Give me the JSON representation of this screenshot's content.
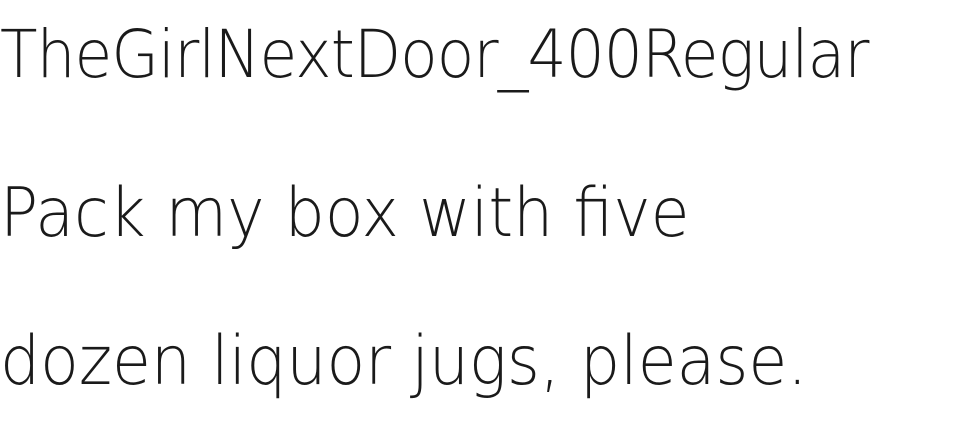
{
  "sample": {
    "font_name": "TheGirlNextDoor_400Regular",
    "pangram_line_1": "Pack my box with five",
    "pangram_line_2": "dozen liquor jugs, please."
  },
  "colors": {
    "text": "#1a1a1a",
    "background": "#ffffff"
  }
}
